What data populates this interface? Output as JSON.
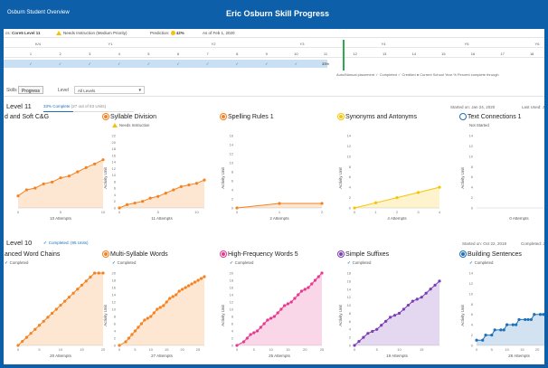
{
  "header": {
    "breadcrumb": "Osburn Student Overview",
    "title": "Eric Osburn Skill Progress"
  },
  "infobar": {
    "course": "Core5 Level 11",
    "status": "Needs Instruction (Medium Priority)",
    "prediction_label": "Prediction:",
    "prediction_value": "42%",
    "as_of": "As of Feb 1, 2020"
  },
  "grade_row": [
    "K/4",
    "Y1",
    "Y2",
    "Y3",
    "Y4",
    "Y5",
    "Y6"
  ],
  "level_numbers": [
    "1",
    "2",
    "3",
    "4",
    "5",
    "6",
    "7",
    "8",
    "9",
    "10",
    "11",
    "12",
    "13",
    "14",
    "15",
    "16",
    "17",
    "18",
    "19",
    "20"
  ],
  "progress_row": [
    "✓",
    "✓",
    "✓",
    "✓",
    "✓",
    "✓",
    "✓",
    "✓",
    "✓",
    "✓",
    "33%"
  ],
  "legend": "Auto/Manual placement  ✓ Completed  ✓ Credited  ● Current School Year  % Percent complete through",
  "controls": {
    "tab_skills": "Skills",
    "tab_progress": "Progress",
    "level_label": "Level",
    "level_value": "All Levels"
  },
  "level11": {
    "title": "Level 11",
    "complete": "33% Complete",
    "units": "(27 out of 83 Units)",
    "started": "Started on: Jan 24, 2020",
    "last_used": "Last Used: Ja",
    "cards": [
      {
        "title": "d and Soft C&G",
        "status": "",
        "color": "#f58220",
        "xlabel": "10 Attempts",
        "xticks": [
          "0",
          "5",
          "10"
        ],
        "yticks": [],
        "ylabel": "",
        "points": [
          [
            0,
            2
          ],
          [
            1,
            3
          ],
          [
            2,
            3.3
          ],
          [
            3,
            4
          ],
          [
            4,
            4.3
          ],
          [
            5,
            5
          ],
          [
            6,
            5.3
          ],
          [
            7,
            6
          ],
          [
            8,
            6.7
          ],
          [
            9,
            7.3
          ],
          [
            10,
            8
          ]
        ],
        "xmax": 10,
        "ymax": 12
      },
      {
        "title": "Syllable Division",
        "status": "Needs Instruction",
        "color": "#f58220",
        "xlabel": "11 Attempts",
        "xticks": [
          "0",
          "5",
          "10"
        ],
        "yticks": [
          "0",
          "2",
          "4",
          "6",
          "8",
          "10",
          "12",
          "14",
          "16",
          "18",
          "20",
          "22"
        ],
        "ylabel": "Activity Unit",
        "points": [
          [
            0,
            0
          ],
          [
            1,
            1
          ],
          [
            2,
            1.5
          ],
          [
            3,
            2
          ],
          [
            4,
            3
          ],
          [
            5,
            3.5
          ],
          [
            6,
            4.5
          ],
          [
            7,
            5.5
          ],
          [
            8,
            6.5
          ],
          [
            9,
            7
          ],
          [
            10,
            7.5
          ],
          [
            11,
            8.5
          ]
        ],
        "xmax": 11,
        "ymax": 22
      },
      {
        "title": "Spelling Rules 1",
        "status": "",
        "color": "#f58220",
        "xlabel": "2 Attempts",
        "xticks": [
          "0",
          "1",
          "2"
        ],
        "yticks": [
          "0",
          "2",
          "4",
          "6",
          "8",
          "10",
          "12",
          "14",
          "16"
        ],
        "ylabel": "Activity Unit",
        "points": [
          [
            0,
            0
          ],
          [
            1,
            1
          ],
          [
            2,
            1
          ]
        ],
        "xmax": 2,
        "ymax": 16
      },
      {
        "title": "Synonyms and Antonyms",
        "status": "",
        "color": "#f7c500",
        "xlabel": "4 Attempts",
        "xticks": [
          "0",
          "1",
          "2",
          "3",
          "4"
        ],
        "yticks": [
          "0",
          "2",
          "4",
          "6",
          "8",
          "10",
          "12",
          "14"
        ],
        "ylabel": "Activity Unit",
        "points": [
          [
            0,
            0
          ],
          [
            1,
            1
          ],
          [
            2,
            2
          ],
          [
            3,
            3
          ],
          [
            4,
            4
          ]
        ],
        "xmax": 4,
        "ymax": 14
      },
      {
        "title": "Text Connections 1",
        "status": "Not Started",
        "color": "#1c6fb9",
        "xlabel": "0 Attempts",
        "xticks": [],
        "yticks": [
          "0",
          "2",
          "4",
          "6",
          "8",
          "10",
          "12",
          "14"
        ],
        "ylabel": "Activity Unit",
        "points": [],
        "xmax": 4,
        "ymax": 14
      }
    ]
  },
  "level10": {
    "title": "Level 10",
    "complete": "Completed: (95 Units)",
    "started": "Started on: Oct 22, 2019",
    "last_used": "Completed: Ja",
    "cards": [
      {
        "title": "anced Word Chains",
        "status": "Completed",
        "color": "#f58220",
        "xlabel": "20 Attempts",
        "xticks": [
          "0",
          "5",
          "10",
          "15",
          "20"
        ],
        "yticks": [],
        "ylabel": "",
        "points": [
          [
            0,
            0
          ],
          [
            1,
            1
          ],
          [
            2,
            2
          ],
          [
            3,
            3
          ],
          [
            4,
            4
          ],
          [
            5,
            5
          ],
          [
            6,
            6
          ],
          [
            7,
            7
          ],
          [
            8,
            8
          ],
          [
            9,
            9
          ],
          [
            10,
            10
          ],
          [
            11,
            11
          ],
          [
            12,
            12
          ],
          [
            13,
            13
          ],
          [
            14,
            14
          ],
          [
            15,
            15
          ],
          [
            16,
            16
          ],
          [
            17,
            17
          ],
          [
            18,
            18
          ],
          [
            19,
            18
          ],
          [
            20,
            18
          ]
        ],
        "xmax": 20,
        "ymax": 18
      },
      {
        "title": "Multi-Syllable Words",
        "status": "Completed",
        "color": "#f58220",
        "xlabel": "27 Attempts",
        "xticks": [
          "0",
          "5",
          "10",
          "15",
          "20",
          "25"
        ],
        "yticks": [
          "0",
          "2",
          "4",
          "6",
          "8",
          "10",
          "12",
          "14",
          "16",
          "18",
          "20"
        ],
        "ylabel": "Activity Unit",
        "points": [
          [
            0,
            0
          ],
          [
            2,
            1
          ],
          [
            3,
            2
          ],
          [
            4,
            3
          ],
          [
            5,
            4
          ],
          [
            6,
            5
          ],
          [
            7,
            6
          ],
          [
            8,
            7
          ],
          [
            9,
            7.5
          ],
          [
            10,
            8
          ],
          [
            11,
            9
          ],
          [
            12,
            10
          ],
          [
            13,
            10.5
          ],
          [
            14,
            11
          ],
          [
            15,
            12
          ],
          [
            16,
            13
          ],
          [
            17,
            13.5
          ],
          [
            18,
            14
          ],
          [
            19,
            15
          ],
          [
            20,
            15.5
          ],
          [
            21,
            16
          ],
          [
            22,
            16.5
          ],
          [
            23,
            17
          ],
          [
            24,
            17.5
          ],
          [
            25,
            18
          ],
          [
            26,
            18.5
          ],
          [
            27,
            19
          ]
        ],
        "xmax": 27,
        "ymax": 20
      },
      {
        "title": "High-Frequency Words 5",
        "status": "Completed",
        "color": "#e6388e",
        "xlabel": "25 Attempts",
        "xticks": [
          "0",
          "5",
          "10",
          "15",
          "20",
          "25"
        ],
        "yticks": [
          "0",
          "2",
          "4",
          "6",
          "8",
          "10",
          "12",
          "14",
          "16",
          "18",
          "20"
        ],
        "ylabel": "Activity Unit",
        "points": [
          [
            0,
            0
          ],
          [
            2,
            1
          ],
          [
            3,
            2
          ],
          [
            4,
            3
          ],
          [
            5,
            3.5
          ],
          [
            6,
            4
          ],
          [
            7,
            5
          ],
          [
            8,
            6
          ],
          [
            9,
            7
          ],
          [
            10,
            7.5
          ],
          [
            11,
            8
          ],
          [
            12,
            9
          ],
          [
            13,
            10
          ],
          [
            14,
            11
          ],
          [
            15,
            11.5
          ],
          [
            16,
            12
          ],
          [
            17,
            13
          ],
          [
            18,
            14
          ],
          [
            19,
            15
          ],
          [
            20,
            15.5
          ],
          [
            21,
            16
          ],
          [
            22,
            17
          ],
          [
            23,
            18
          ],
          [
            24,
            19
          ],
          [
            25,
            20
          ]
        ],
        "xmax": 25,
        "ymax": 20
      },
      {
        "title": "Simple Suffixes",
        "status": "Completed",
        "color": "#7a3db8",
        "xlabel": "19 Attempts",
        "xticks": [
          "0",
          "5",
          "10",
          "15"
        ],
        "yticks": [
          "0",
          "2",
          "4",
          "6",
          "8",
          "10",
          "12",
          "14",
          "16",
          "18"
        ],
        "ylabel": "Activity Unit",
        "points": [
          [
            0,
            0
          ],
          [
            1,
            1
          ],
          [
            2,
            2
          ],
          [
            3,
            3
          ],
          [
            4,
            3.5
          ],
          [
            5,
            4
          ],
          [
            6,
            5
          ],
          [
            7,
            6
          ],
          [
            8,
            7
          ],
          [
            9,
            7.5
          ],
          [
            10,
            8
          ],
          [
            11,
            9
          ],
          [
            12,
            10
          ],
          [
            13,
            11
          ],
          [
            14,
            11.5
          ],
          [
            15,
            12
          ],
          [
            16,
            13
          ],
          [
            17,
            14
          ],
          [
            18,
            15
          ],
          [
            19,
            16
          ]
        ],
        "xmax": 19,
        "ymax": 18
      },
      {
        "title": "Building Sentences",
        "status": "Completed",
        "color": "#1c6fb9",
        "xlabel": "28 Attempts",
        "xticks": [
          "0",
          "5",
          "10",
          "15",
          "20",
          "25"
        ],
        "yticks": [
          "0",
          "2",
          "4",
          "6",
          "8",
          "10",
          "12",
          "14"
        ],
        "ylabel": "Activity Unit",
        "points": [
          [
            0,
            1
          ],
          [
            2,
            1
          ],
          [
            3,
            2
          ],
          [
            5,
            2
          ],
          [
            6,
            3
          ],
          [
            8,
            3
          ],
          [
            9,
            3
          ],
          [
            10,
            4
          ],
          [
            12,
            4
          ],
          [
            13,
            4
          ],
          [
            14,
            5
          ],
          [
            16,
            5
          ],
          [
            17,
            5
          ],
          [
            18,
            5
          ],
          [
            19,
            6
          ],
          [
            21,
            6
          ],
          [
            22,
            6
          ],
          [
            23,
            6
          ],
          [
            25,
            6
          ],
          [
            26,
            7
          ],
          [
            28,
            7
          ]
        ],
        "xmax": 28,
        "ymax": 14
      }
    ]
  }
}
